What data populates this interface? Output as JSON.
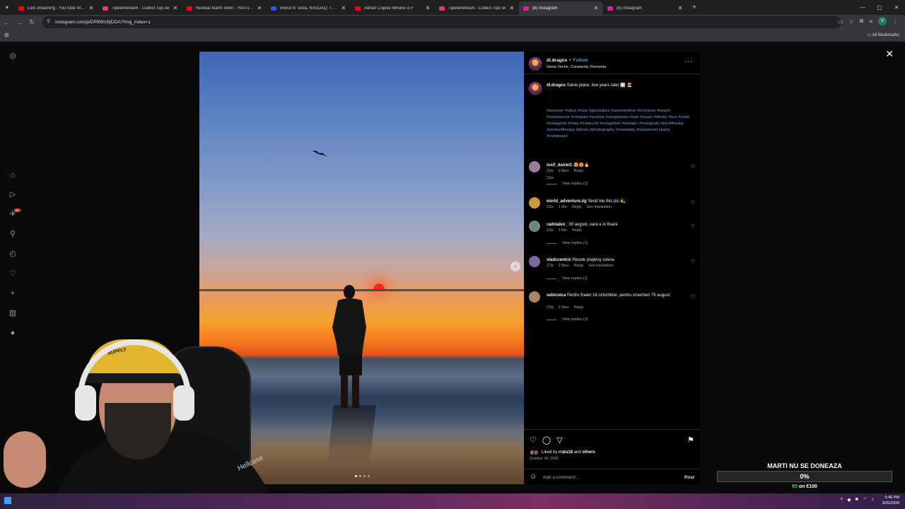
{
  "browser": {
    "tabs": [
      {
        "title": "Live streaming - YouTube Studio",
        "fav_color": "#ff0000",
        "active": false
      },
      {
        "title": "TipeeeStream - Collect Tips wi",
        "fav_color": "#e8396a",
        "active": false
      },
      {
        "title": "Nuclear Alarm Siren - YouTube",
        "fav_color": "#ff0000",
        "active": false
      },
      {
        "title": "Invest in Tesla, NASDAQ: TSLA",
        "fav_color": "#2b5bd7",
        "active": false
      },
      {
        "title": "Adrian Copilul Minune si F",
        "fav_color": "#ff0000",
        "active": false
      },
      {
        "title": "TipeeeStream - Collect Tips wi",
        "fav_color": "#e8396a",
        "active": false
      },
      {
        "title": "(8) Instagram",
        "fav_color": "#d6249f",
        "active": true
      },
      {
        "title": "(9) Instagram",
        "fav_color": "#d6249f",
        "active": false
      }
    ],
    "url": "instagram.com/p/DP9Wx3tjDDA/?img_index=1",
    "bookmarks_label": "All Bookmarks",
    "profile_initial": "V"
  },
  "post": {
    "username": "dl.dragos",
    "follow_label": "Follow",
    "location": "Vama Veche, Constanta, Romania",
    "caption_text": "Same place, few years later 🌅 🏖️",
    "hashtags": "#summer #vibes #new #goodvibes #summertime #moments #beach #vamaveche #romania #sunrise #sunglasses #sun #music #drinks #sea #relax #instagood #insta #instacool #instaphoto #instapic #instagram #picoftheday #photooftheday #photo #photography #instadaily #instamood #party #instatravel",
    "caption_time": "22w",
    "comments": [
      {
        "user": "iosif_daniel1",
        "text": "😍😍🔥",
        "time": "22w",
        "likes": "2 likes",
        "reply": "Reply",
        "translate": "",
        "view_replies": "View replies (1)",
        "avatar_color": "#9c7a9a"
      },
      {
        "user": "world_adventure.iig",
        "text": "Send me this pic 💫",
        "time": "22w",
        "likes": "1 like",
        "reply": "Reply",
        "translate": "See translation",
        "view_replies": "",
        "avatar_color": "#c89a3a"
      },
      {
        "user": "radoialex_",
        "text": "30 august, vara e in floare",
        "time": "22w",
        "likes": "1 like",
        "reply": "Reply",
        "translate": "",
        "view_replies": "View replies (1)",
        "avatar_color": "#6f8a7a"
      },
      {
        "user": "vladccentric",
        "text": "Recele playboy sirena",
        "time": "22w",
        "likes": "2 likes",
        "reply": "Reply",
        "translate": "See translation",
        "view_replies": "View replies (1)",
        "avatar_color": "#7a6a9a"
      },
      {
        "user": "sebicoica",
        "text": "Pentru fraieri 18 octombrie, pentru smecheri 79 august",
        "time": "22w",
        "likes": "2 likes",
        "reply": "Reply",
        "translate": "",
        "view_replies": "View replies (1)",
        "avatar_color": "#a58660"
      }
    ],
    "liked_by_prefix": "Liked by",
    "liked_by_user": "rralu18",
    "liked_by_and": "and",
    "liked_by_others": "others",
    "date": "October 18, 2025",
    "add_comment_placeholder": "Add a comment...",
    "post_label": "Post",
    "carousel_index": 1,
    "carousel_count": 4
  },
  "icons": {
    "sidebar": [
      "instagram-icon",
      "home-icon",
      "reels-icon",
      "messages-icon",
      "search-icon",
      "explore-icon",
      "notifications-icon",
      "create-icon",
      "dashboard-icon",
      "profile-icon"
    ],
    "sidebar_badge": "9+"
  },
  "overlay": {
    "cap_text": "SUPPLY",
    "jersey_text": "Hellcase",
    "donation_title": "MARTI NU SE DONEAZA",
    "donation_percent": "0%",
    "donation_value": 0,
    "donation_current": "€0",
    "donation_of": "on",
    "donation_goal": "€100"
  },
  "system": {
    "time": "5:46 PM",
    "date": "3/25/2026"
  }
}
